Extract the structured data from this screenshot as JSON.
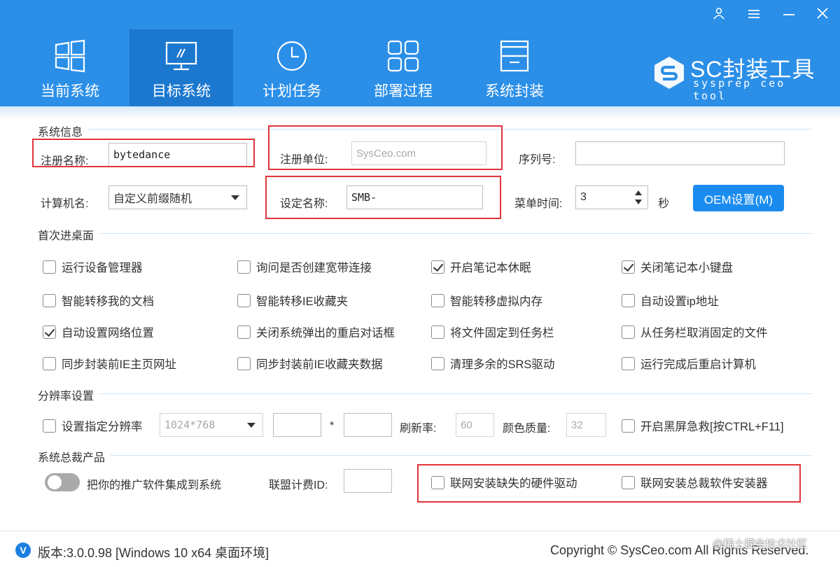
{
  "window": {
    "user_icon": "user-icon",
    "menu_icon": "menu-icon",
    "minimize_icon": "minimize-icon",
    "close_icon": "close-icon"
  },
  "tabs": [
    {
      "label": "当前系统",
      "icon": "windows-icon"
    },
    {
      "label": "目标系统",
      "icon": "monitor-icon"
    },
    {
      "label": "计划任务",
      "icon": "clock-icon"
    },
    {
      "label": "部署过程",
      "icon": "grid-icon"
    },
    {
      "label": "系统封装",
      "icon": "package-icon"
    }
  ],
  "active_tab": "目标系统",
  "brand": {
    "name": "SC封装工具",
    "subtitle": "sysprep ceo tool"
  },
  "system_info": {
    "title": "系统信息",
    "reg_name_label": "注册名称:",
    "reg_name_value": "bytedance",
    "reg_org_label": "注册单位:",
    "reg_org_placeholder": "SysCeo.com",
    "serial_label": "序列号:",
    "serial_value": "",
    "computer_name_label": "计算机名:",
    "computer_name_value": "自定义前缀随机",
    "set_name_label": "设定名称:",
    "set_name_value": "SMB-",
    "menu_time_label": "菜单时间:",
    "menu_time_value": "3",
    "menu_time_unit": "秒",
    "oem_button": "OEM设置(M)"
  },
  "first_desktop": {
    "title": "首次进桌面",
    "options": [
      {
        "label": "运行设备管理器",
        "checked": false
      },
      {
        "label": "询问是否创建宽带连接",
        "checked": false
      },
      {
        "label": "开启笔记本休眠",
        "checked": true
      },
      {
        "label": "关闭笔记本小键盘",
        "checked": true
      },
      {
        "label": "智能转移我的文档",
        "checked": false
      },
      {
        "label": "智能转移IE收藏夹",
        "checked": false
      },
      {
        "label": "智能转移虚拟内存",
        "checked": false
      },
      {
        "label": "自动设置ip地址",
        "checked": false
      },
      {
        "label": "自动设置网络位置",
        "checked": true
      },
      {
        "label": "关闭系统弹出的重启对话框",
        "checked": false
      },
      {
        "label": "将文件固定到任务栏",
        "checked": false
      },
      {
        "label": "从任务栏取消固定的文件",
        "checked": false
      },
      {
        "label": "同步封装前IE主页网址",
        "checked": false
      },
      {
        "label": "同步封装前IE收藏夹数据",
        "checked": false
      },
      {
        "label": "清理多余的SRS驱动",
        "checked": false
      },
      {
        "label": "运行完成后重启计算机",
        "checked": false
      }
    ]
  },
  "resolution": {
    "title": "分辨率设置",
    "set_label": "设置指定分辨率",
    "set_checked": false,
    "res_value": "1024*768",
    "width_value": "",
    "times": "*",
    "height_value": "",
    "refresh_label": "刷新率:",
    "refresh_value": "60",
    "color_label": "颜色质量:",
    "color_value": "32",
    "blackscreen_label": "开启黑屏急救[按CTRL+F11]",
    "blackscreen_checked": false
  },
  "products": {
    "title": "系统总裁产品",
    "promo_toggle_label": "把你的推广软件集成到系统",
    "promo_toggle_on": false,
    "alliance_label": "联盟计费ID:",
    "alliance_value": "",
    "driver_label": "联网安装缺失的硬件驱动",
    "driver_checked": false,
    "installer_label": "联网安装总裁软件安装器",
    "installer_checked": false
  },
  "footer": {
    "version_icon": "V",
    "version": "版本:3.0.0.98 [Windows 10 x64 桌面环境]",
    "copyright": "Copyright © SysCeo.com All Rights Reserved.",
    "watermark": "@稀土掘金技术社区"
  },
  "colors": {
    "header": "#2b8fe8",
    "active_tab": "#1c78cf",
    "button": "#1a8cf0",
    "highlight_box": "#e0353b"
  }
}
